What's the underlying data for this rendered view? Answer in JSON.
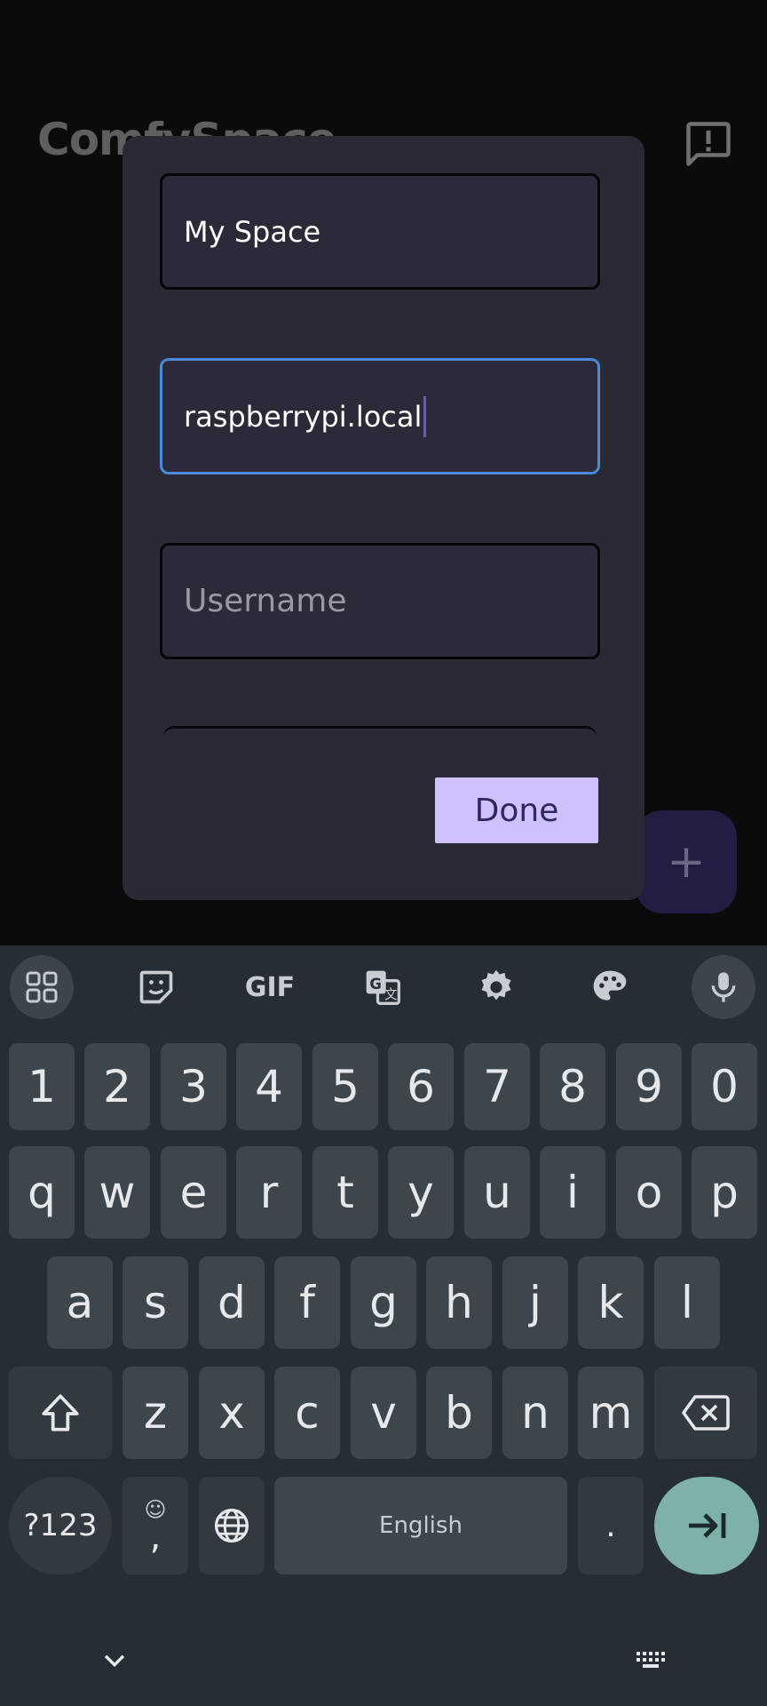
{
  "app": {
    "title": "ComfySpace",
    "accent": "#cfc1fc"
  },
  "dialog": {
    "name_value": "My Space",
    "host_value": "raspberrypi.local",
    "username_placeholder": "Username",
    "done_label": "Done"
  },
  "keyboard": {
    "toolbar": [
      "apps-grid-icon",
      "sticker-icon",
      "gif-icon",
      "translate-icon",
      "settings-gear-icon",
      "palette-icon",
      "microphone-icon"
    ],
    "gif_label": "GIF",
    "numbers": [
      "1",
      "2",
      "3",
      "4",
      "5",
      "6",
      "7",
      "8",
      "9",
      "0"
    ],
    "row1": [
      "q",
      "w",
      "e",
      "r",
      "t",
      "y",
      "u",
      "i",
      "o",
      "p"
    ],
    "row2": [
      "a",
      "s",
      "d",
      "f",
      "g",
      "h",
      "j",
      "k",
      "l"
    ],
    "row3": [
      "z",
      "x",
      "c",
      "v",
      "b",
      "n",
      "m"
    ],
    "symbols_label": "?123",
    "comma_label": ",",
    "emoji_label": "☺",
    "space_label": "English",
    "period_label": "."
  }
}
